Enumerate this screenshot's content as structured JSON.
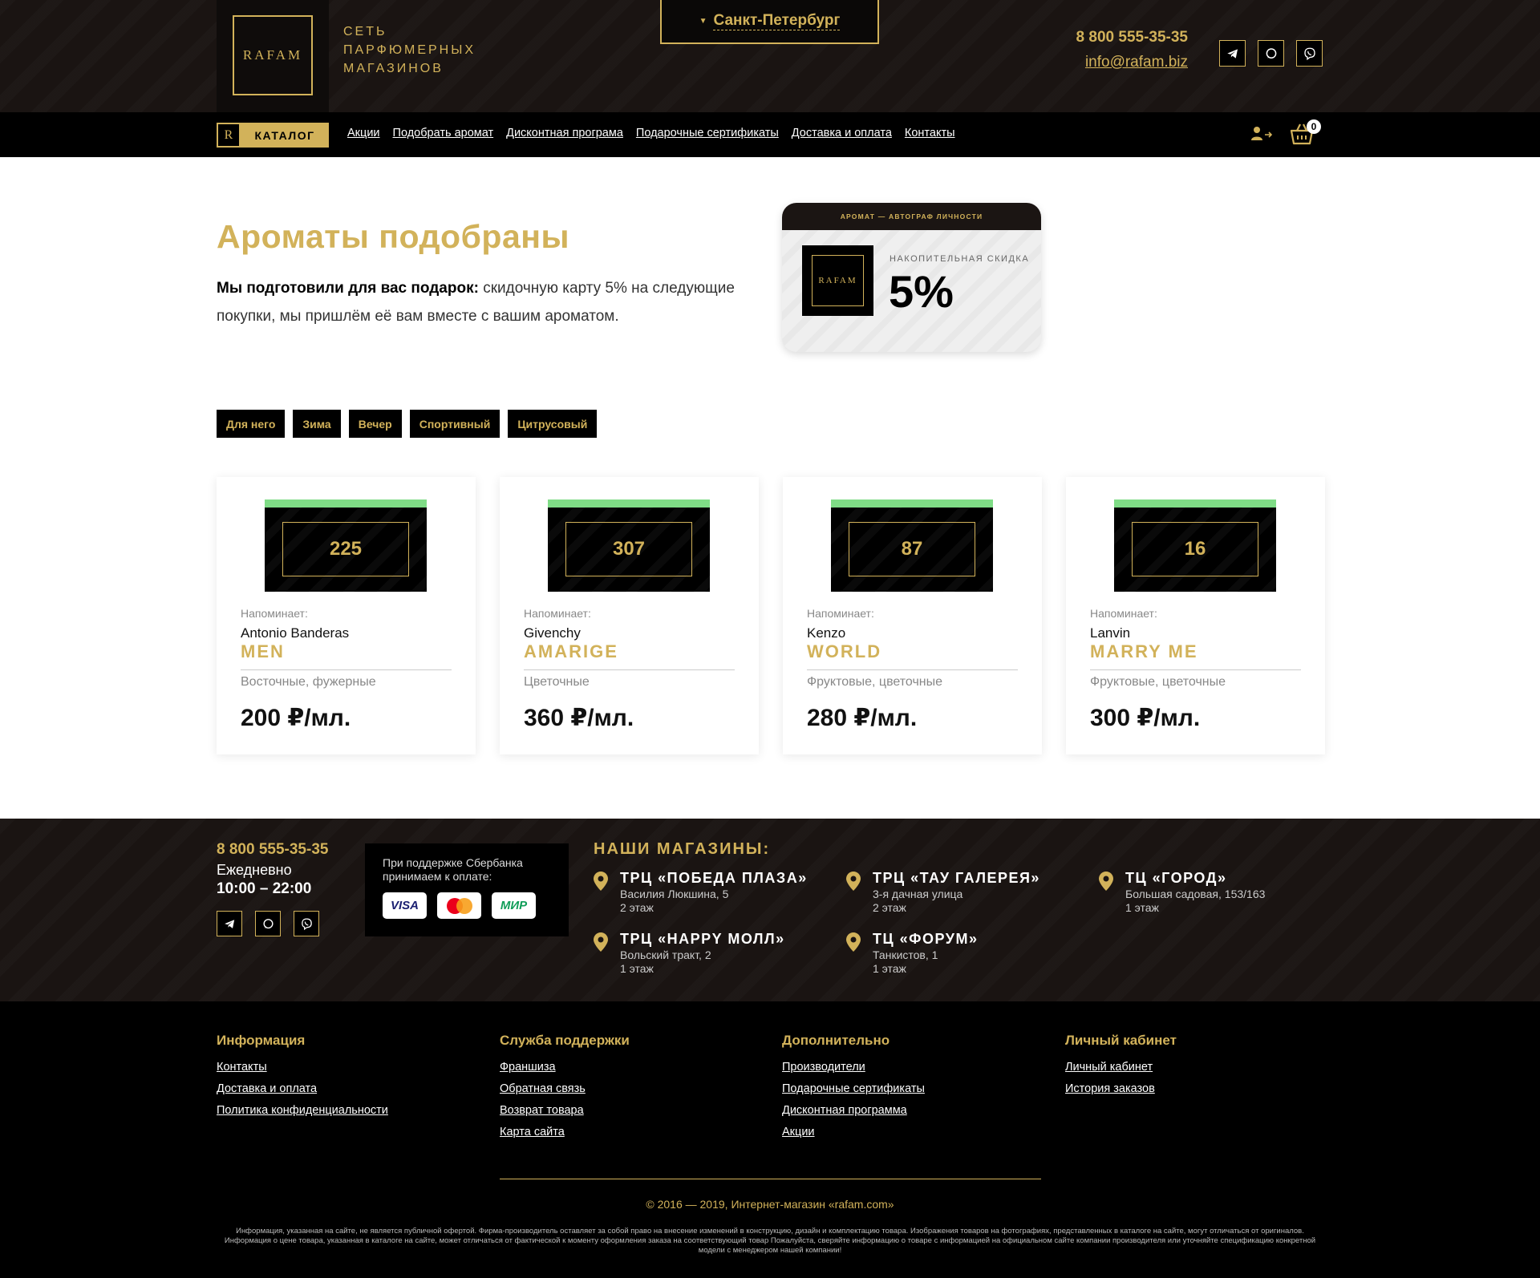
{
  "header": {
    "logo_text": "RAFAM",
    "tagline": "Сеть парфюмерных магазинов",
    "city": "Санкт-Петербург",
    "phone": "8 800 555-35-35",
    "email": "info@rafam.biz",
    "socials": [
      "telegram-icon",
      "whatsapp-icon",
      "viber-icon"
    ]
  },
  "nav": {
    "catalog_letter": "R",
    "catalog_label": "КАТАЛОГ",
    "links": [
      "Акции",
      "Подобрать аромат",
      "Дисконтная програма",
      "Подарочные сертификаты",
      "Доставка и оплата",
      "Контакты"
    ],
    "cart_count": "0"
  },
  "main": {
    "title": "Ароматы подобраны",
    "intro_bold": "Мы подготовили для вас подарок:",
    "intro_text": " скидочную карту 5% на следующие покупки, мы пришлём её вам вместе с вашим ароматом."
  },
  "promo_card": {
    "header": "Аромат — автограф личности",
    "logo": "RAFAM",
    "label": "Накопительная скидка",
    "value": "5%"
  },
  "tags": [
    "Для него",
    "Зима",
    "Вечер",
    "Спортивный",
    "Цитрусовый"
  ],
  "products": [
    {
      "number": "225",
      "remind": "Напоминает:",
      "brand": "Antonio Banderas",
      "name": "MEN",
      "notes": "Восточные, фужерные",
      "price": "200 ₽/мл."
    },
    {
      "number": "307",
      "remind": "Напоминает:",
      "brand": "Givenchy",
      "name": "AMARIGE",
      "notes": "Цветочные",
      "price": "360 ₽/мл."
    },
    {
      "number": "87",
      "remind": "Напоминает:",
      "brand": "Kenzo",
      "name": "WORLD",
      "notes": "Фруктовые, цветочные",
      "price": "280 ₽/мл."
    },
    {
      "number": "16",
      "remind": "Напоминает:",
      "brand": "Lanvin",
      "name": "MARRY ME",
      "notes": "Фруктовые, цветочные",
      "price": "300 ₽/мл."
    }
  ],
  "footer": {
    "phone": "8 800 555-35-35",
    "daily": "Ежедневно",
    "hours": "10:00 – 22:00",
    "payment_text": "При поддержке Сбербанка принимаем к оплате:",
    "payment_cards": [
      "VISA",
      "mastercard",
      "МИР"
    ],
    "stores_title": "НАШИ МАГАЗИНЫ:",
    "stores": [
      {
        "name": "ТРЦ «ПОБЕДА ПЛАЗА»",
        "address": "Василия Люкшина, 5",
        "floor": "2 этаж"
      },
      {
        "name": "ТРЦ «ТАУ ГАЛЕРЕЯ»",
        "address": "3-я дачная улица",
        "floor": "2 этаж"
      },
      {
        "name": "ТЦ «ГОРОД»",
        "address": "Большая садовая, 153/163",
        "floor": "1 этаж"
      },
      {
        "name": "ТРЦ «HAPPY МОЛЛ»",
        "address": "Вольский тракт, 2",
        "floor": "1 этаж"
      },
      {
        "name": "ТЦ «ФОРУМ»",
        "address": "Танкистов, 1",
        "floor": "1 этаж"
      }
    ],
    "columns": [
      {
        "title": "Информация",
        "links": [
          "Контакты",
          "Доставка и оплата",
          "Политика конфиденциальности"
        ]
      },
      {
        "title": "Служба поддержки",
        "links": [
          "Франшиза",
          "Обратная связь",
          "Возврат товара",
          "Карта сайта"
        ]
      },
      {
        "title": "Дополнительно",
        "links": [
          "Производители",
          "Подарочные сертификаты",
          "Дисконтная программа",
          "Акции"
        ]
      },
      {
        "title": "Личный кабинет",
        "links": [
          "Личный кабинет",
          "История заказов"
        ]
      }
    ],
    "copyright": "© 2016 — 2019, Интернет-магазин «rafam.com»",
    "disclaimer": "Информация, указанная на сайте, не является публичной офертой. Фирма-производитель оставляет за собой право на внесение изменений в конструкцию, дизайн и комплектацию товара. Изображения товаров на фотографиях, представленных в каталоге на сайте, могут отличаться от оригиналов. Информация о цене товара, указанная в каталоге на сайте, может отличаться от фактической к моменту оформления заказа на соответствующий товар Пожалуйста, сверяйте информацию о товаре с информацией на официальном сайте компании производителя или уточняйте спецификацию конкретной модели с менеджером нашей компании!"
  },
  "colors": {
    "accent": "#d2b25a",
    "dark": "#1a1412",
    "stripe": "#7fdc86"
  }
}
